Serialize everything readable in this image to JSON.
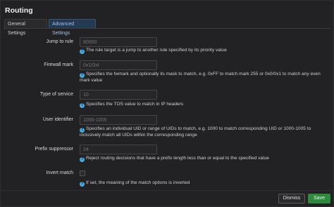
{
  "modal": {
    "title": "Routing"
  },
  "tabs": [
    {
      "label": "General Settings"
    },
    {
      "label": "Advanced Settings"
    }
  ],
  "fields": {
    "jump_to_rule": {
      "label": "Jump to rule",
      "placeholder": "80000",
      "help": "The rule target is a jump to another rule specified by its priority value"
    },
    "firewall_mark": {
      "label": "Firewall mark",
      "placeholder": "0x1/0xf",
      "help": "Specifies the fwmark and optionally its mask to match, e.g. 0xFF to match mark 255 or 0x0/0x1 to match any even mark value"
    },
    "type_of_service": {
      "label": "Type of service",
      "placeholder": "10",
      "help": "Specifies the TOS value to match in IP headers"
    },
    "user_identifier": {
      "label": "User identifier",
      "placeholder": "1000-1005",
      "help": "Specifies an individual UID or range of UIDs to match, e.g. 1000 to match corresponding UID or 1000-1005 to inclusively match all UIDs within the corresponding range"
    },
    "prefix_suppressor": {
      "label": "Prefix suppressor",
      "placeholder": "24",
      "help": "Reject routing decisions that have a prefix length less than or equal to the specified value"
    },
    "invert_match": {
      "label": "Invert match",
      "checked": false,
      "help": "If set, the meaning of the match options is inverted"
    }
  },
  "footer": {
    "dismiss_label": "Dismiss",
    "save_label": "Save"
  }
}
